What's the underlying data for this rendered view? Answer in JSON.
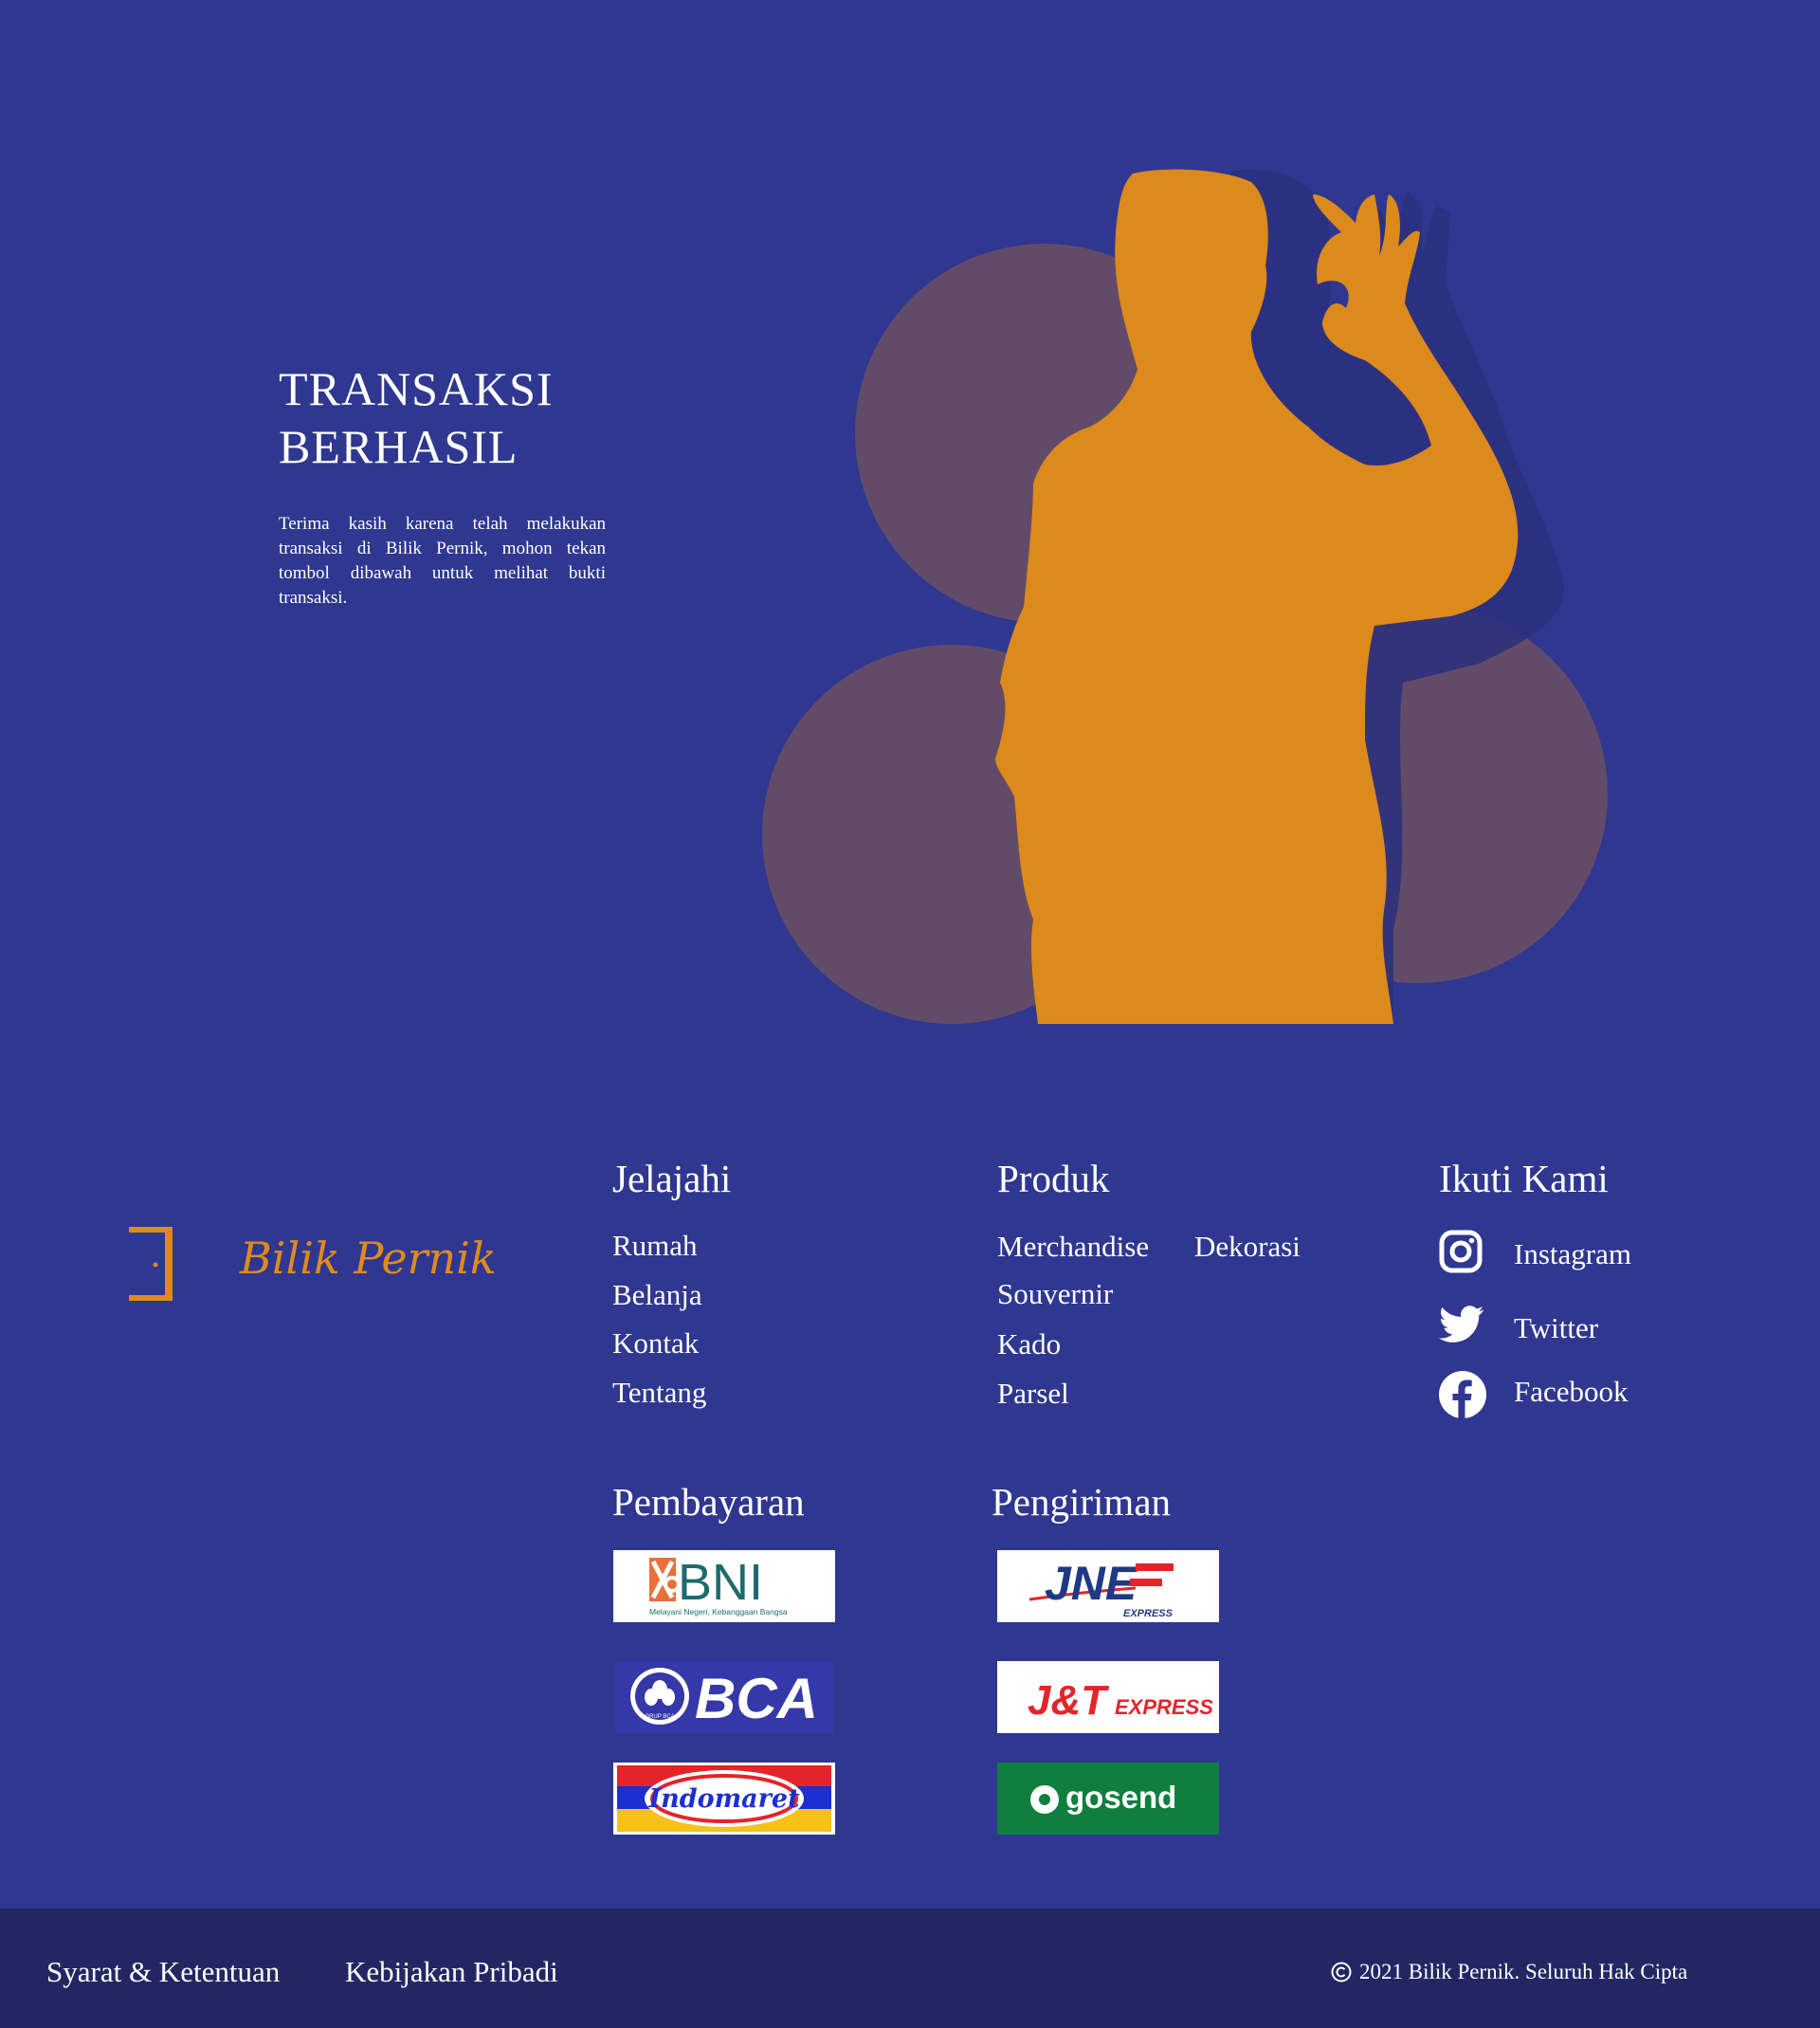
{
  "hero": {
    "title_line1": "TRANSAKSI",
    "title_line2": "BERHASIL",
    "description": "Terima kasih karena telah melakukan transaksi di Bilik Pernik, mohon tekan tombol dibawah untuk melihat bukti transaksi."
  },
  "brand": {
    "name": "Bilik Pernik"
  },
  "footer": {
    "explore": {
      "title": "Jelajahi",
      "links": [
        "Rumah",
        "Belanja",
        "Kontak",
        "Tentang"
      ]
    },
    "products": {
      "title": "Produk",
      "links": [
        "Merchandise",
        "Dekorasi",
        "Souvernir",
        "Kado",
        "Parsel"
      ]
    },
    "follow": {
      "title": "Ikuti Kami",
      "items": [
        {
          "label": "Instagram",
          "icon": "instagram-icon"
        },
        {
          "label": "Twitter",
          "icon": "twitter-icon"
        },
        {
          "label": "Facebook",
          "icon": "facebook-icon"
        }
      ]
    },
    "payment": {
      "title": "Pembayaran",
      "logos": [
        "BNI",
        "Melayani Negeri, Kebanggaan Bangsa",
        "BCA",
        "GRUP BCA",
        "Indomaret"
      ]
    },
    "shipping": {
      "title": "Pengiriman",
      "logos": [
        "JNE",
        "EXPRESS",
        "J&T",
        "EXPRESS",
        "gosend"
      ]
    }
  },
  "bottom": {
    "terms": "Syarat & Ketentuan",
    "privacy": "Kebijakan Pribadi",
    "copyright": "2021 Bilik Pernik. Seluruh Hak Cipta"
  },
  "colors": {
    "background": "#2f3790",
    "bottom_bar": "#222764",
    "accent_orange": "#dc8a1c",
    "circle": "#624b68"
  }
}
